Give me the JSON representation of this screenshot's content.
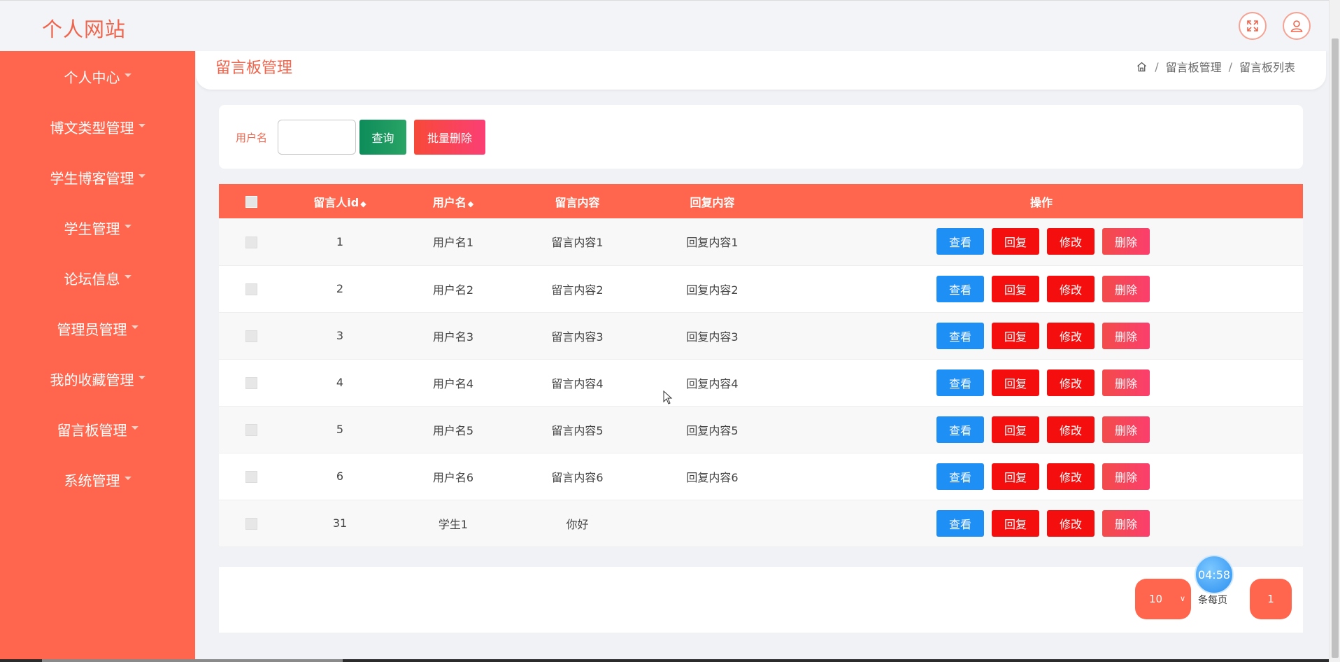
{
  "app": {
    "title": "个人网站"
  },
  "header": {
    "fullscreen_icon": "fullscreen-icon",
    "user_icon": "user-icon"
  },
  "sidebar": {
    "items": [
      {
        "label": "个人中心"
      },
      {
        "label": "博文类型管理"
      },
      {
        "label": "学生博客管理"
      },
      {
        "label": "学生管理"
      },
      {
        "label": "论坛信息"
      },
      {
        "label": "管理员管理"
      },
      {
        "label": "我的收藏管理"
      },
      {
        "label": "留言板管理"
      },
      {
        "label": "系统管理"
      }
    ]
  },
  "page": {
    "title": "留言板管理",
    "breadcrumb": {
      "home_icon": "home-icon",
      "level1": "留言板管理",
      "level2": "留言板列表",
      "separator": "/"
    }
  },
  "search": {
    "label": "用户名",
    "value": "",
    "placeholder": "",
    "query_button": "查询",
    "batch_delete_button": "批量删除"
  },
  "table": {
    "columns": [
      "留言人id",
      "用户名",
      "留言内容",
      "回复内容",
      "操作"
    ],
    "sort_glyph": "◆",
    "rows": [
      {
        "id": "1",
        "username": "用户名1",
        "content": "留言内容1",
        "reply": "回复内容1"
      },
      {
        "id": "2",
        "username": "用户名2",
        "content": "留言内容2",
        "reply": "回复内容2"
      },
      {
        "id": "3",
        "username": "用户名3",
        "content": "留言内容3",
        "reply": "回复内容3"
      },
      {
        "id": "4",
        "username": "用户名4",
        "content": "留言内容4",
        "reply": "回复内容4"
      },
      {
        "id": "5",
        "username": "用户名5",
        "content": "留言内容5",
        "reply": "回复内容5"
      },
      {
        "id": "6",
        "username": "用户名6",
        "content": "留言内容6",
        "reply": "回复内容6"
      },
      {
        "id": "31",
        "username": "学生1",
        "content": "你好",
        "reply": ""
      }
    ],
    "actions": {
      "view": "查看",
      "reply": "回复",
      "edit": "修改",
      "delete": "删除"
    }
  },
  "pagination": {
    "page_size": "10",
    "per_page_label": "条每页",
    "current_page": "1"
  },
  "timer": {
    "value": "04:58"
  },
  "colors": {
    "accent": "#ff664d",
    "view_button": "#1e8ff4",
    "reply_button": "#f40e0e",
    "query_button": "#159a5e"
  }
}
